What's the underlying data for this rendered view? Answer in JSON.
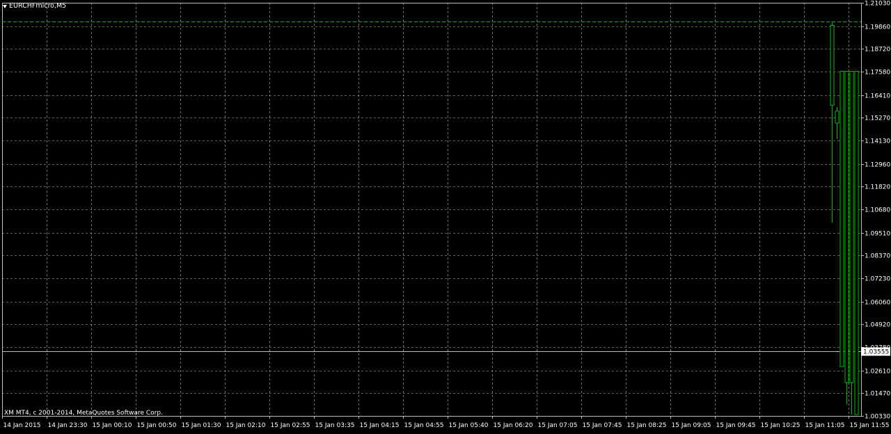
{
  "window": {
    "symbol": "EURCHFmicro,M5",
    "copyright": "XM MT4, c 2001-2014, MetaQuotes Software Corp."
  },
  "colors": {
    "background": "#000000",
    "grid": "#c0c0c0",
    "axis_text": "#ffffff",
    "bull": "#ffffff",
    "bear_border": "#00c000",
    "wick": "#00c000",
    "high_line": "#00c000",
    "bid_line": "#c0c0c0"
  },
  "chart_data": {
    "type": "candlestick",
    "title": "EURCHFmicro,M5",
    "xlabel": "",
    "ylabel": "",
    "grid": true,
    "ylim": [
      1.0033,
      1.2103
    ],
    "y_ticks": [
      "1.21030",
      "1.19860",
      "1.18720",
      "1.17580",
      "1.16410",
      "1.15270",
      "1.14130",
      "1.12960",
      "1.11820",
      "1.10680",
      "1.09510",
      "1.08370",
      "1.07230",
      "1.06060",
      "1.04920",
      "1.03780",
      "1.02610",
      "1.01470",
      "1.00330"
    ],
    "x_ticks": [
      "14 Jan 2015",
      "14 Jan 23:30",
      "15 Jan 00:10",
      "15 Jan 00:50",
      "15 Jan 01:30",
      "15 Jan 02:10",
      "15 Jan 02:55",
      "15 Jan 03:35",
      "15 Jan 04:15",
      "15 Jan 04:55",
      "15 Jan 05:40",
      "15 Jan 06:20",
      "15 Jan 07:05",
      "15 Jan 07:45",
      "15 Jan 08:25",
      "15 Jan 09:05",
      "15 Jan 09:45",
      "15 Jan 10:25",
      "15 Jan 11:05",
      "15 Jan 11:55"
    ],
    "bid_price": "1.03555",
    "high_line_price": 1.2008,
    "candles": [
      {
        "open": 1.199,
        "high": 1.2008,
        "low": 1.1,
        "close": 1.159
      },
      {
        "open": 1.156,
        "high": 1.158,
        "low": 1.142,
        "close": 1.15
      },
      {
        "open": 1.176,
        "high": 1.176,
        "low": 1.028,
        "close": 1.028
      },
      {
        "open": 1.176,
        "high": 1.176,
        "low": 1.009,
        "close": 1.02
      },
      {
        "open": 1.176,
        "high": 1.176,
        "low": 1.004,
        "close": 1.02
      },
      {
        "open": 1.176,
        "high": 1.176,
        "low": 1.004,
        "close": 1.004
      }
    ]
  }
}
